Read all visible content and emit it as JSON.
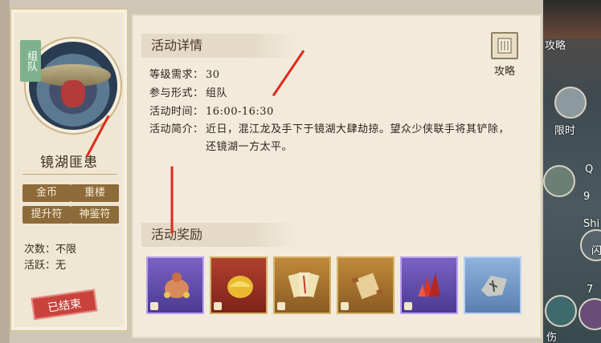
{
  "left_card": {
    "badge": "组队",
    "npc_name": "镜湖匪患",
    "tags": [
      "金币",
      "重楼",
      "提升符",
      "神鉴符"
    ],
    "count_label": "次数：",
    "count_value": "不限",
    "active_label": "活跃：",
    "active_value": "无",
    "status": "已结束"
  },
  "detail": {
    "section_title": "活动详情",
    "guide_label": "攻略",
    "level_label": "等级需求：",
    "level_value": "30",
    "mode_label": "参与形式：",
    "mode_value": "组队",
    "time_label": "活动时间：",
    "time_value": "16:00-16:30",
    "intro_label": "活动简介：",
    "intro_value": "近日，混江龙及手下于镜湖大肆劫掠。望众少侠联手将其铲除，还镜湖一方太平。"
  },
  "rewards": {
    "section_title": "活动奖励",
    "items": [
      "money-bag",
      "gold-ingot",
      "talisman-scrolls",
      "scroll",
      "red-crystal",
      "stone-fragment"
    ]
  },
  "right_strip": {
    "labels": [
      "攻略",
      "限时",
      "Q",
      "Shi",
      "7",
      "伤",
      "9",
      "闪"
    ]
  },
  "colors": {
    "annotation": "#e02a1f",
    "tag_bg": "#8d6a39",
    "ended_bg": "#c9423b",
    "badge_bg": "#7db28c"
  }
}
